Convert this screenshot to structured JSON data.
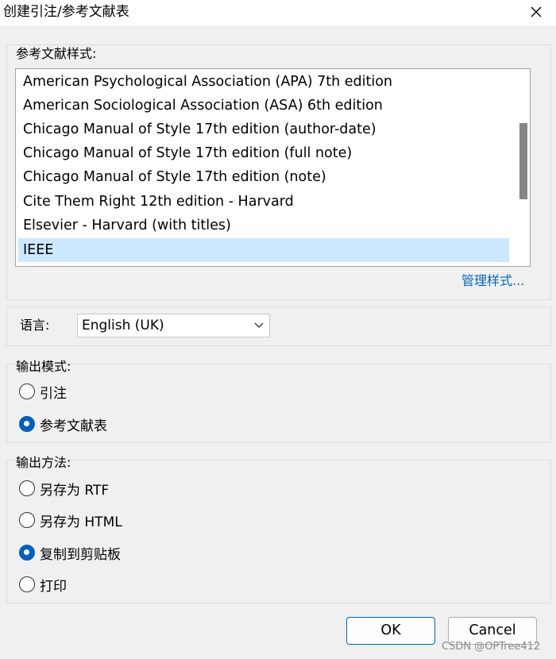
{
  "window": {
    "title": "创建引注/参考文献表",
    "close_icon": "close-icon"
  },
  "styles_group": {
    "label": "参考文献样式:",
    "items": [
      {
        "label": "American Psychological Association (APA) 7th edition",
        "selected": false
      },
      {
        "label": "American Sociological Association (ASA) 6th edition",
        "selected": false
      },
      {
        "label": "Chicago Manual of Style 17th edition (author-date)",
        "selected": false
      },
      {
        "label": "Chicago Manual of Style 17th edition (full note)",
        "selected": false
      },
      {
        "label": "Chicago Manual of Style 17th edition (note)",
        "selected": false
      },
      {
        "label": "Cite Them Right 12th edition - Harvard",
        "selected": false
      },
      {
        "label": "Elsevier - Harvard (with titles)",
        "selected": false
      },
      {
        "label": "IEEE",
        "selected": true
      }
    ],
    "manage_link": "管理样式..."
  },
  "language": {
    "label": "语言:",
    "selected": "English (UK)"
  },
  "output_mode": {
    "label": "输出模式:",
    "options": [
      {
        "label": "引注",
        "checked": false
      },
      {
        "label": "参考文献表",
        "checked": true
      }
    ]
  },
  "output_method": {
    "label": "输出方法:",
    "options": [
      {
        "label": "另存为 RTF",
        "checked": false
      },
      {
        "label": "另存为 HTML",
        "checked": false
      },
      {
        "label": "复制到剪贴板",
        "checked": true
      },
      {
        "label": "打印",
        "checked": false
      }
    ]
  },
  "buttons": {
    "ok": "OK",
    "cancel": "Cancel"
  },
  "watermark": "CSDN @OPTree412",
  "colors": {
    "accent": "#0060c0",
    "selection": "#cce8ff",
    "link": "#0066bf"
  }
}
